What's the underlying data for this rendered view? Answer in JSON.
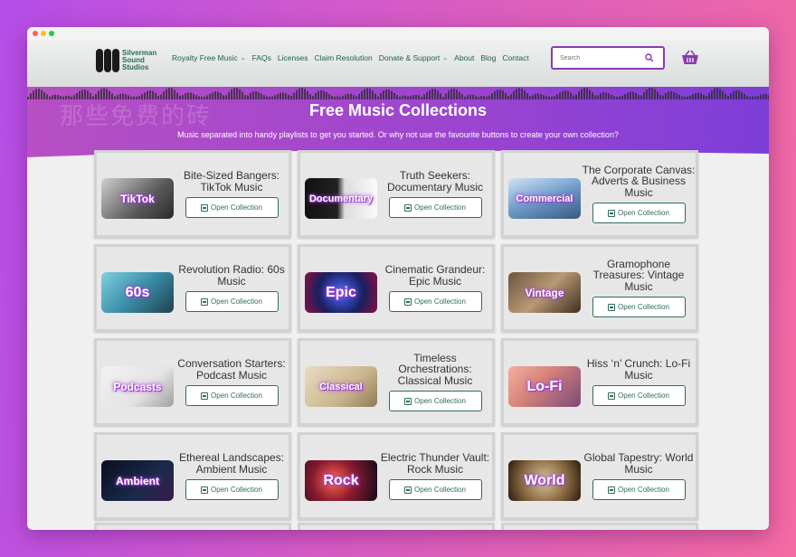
{
  "logo": {
    "lines": [
      "Silverman",
      "Sound",
      "Studios"
    ]
  },
  "nav": [
    {
      "label": "Royalty Free Music",
      "dropdown": true
    },
    {
      "label": "FAQs",
      "dropdown": false
    },
    {
      "label": "Licenses",
      "dropdown": false
    },
    {
      "label": "Claim Resolution",
      "dropdown": false
    },
    {
      "label": "Donate & Support",
      "dropdown": true
    },
    {
      "label": "About",
      "dropdown": false
    },
    {
      "label": "Blog",
      "dropdown": false
    },
    {
      "label": "Contact",
      "dropdown": false
    }
  ],
  "search": {
    "placeholder": "Search"
  },
  "hero": {
    "watermark": "那些免费的砖",
    "title": "Free Music Collections",
    "subtitle": "Music separated into handy playlists to get you started. Or why not use the favourite buttons to create your own collection?"
  },
  "button_label": "Open Collection",
  "colors": {
    "accent": "#8a3ab0",
    "button": "#2f6c5e",
    "hero": "#9a44d0"
  },
  "collections": [
    {
      "title": "Bite-Sized Bangers: TikTok Music",
      "thumb": "TikTok",
      "bg": "linear-gradient(135deg,#cfcfcf,#5a5a5a 60%,#2a2a2a)"
    },
    {
      "title": "Truth Seekers: Documentary Music",
      "thumb": "Documentary",
      "bg": "linear-gradient(90deg,#111 0%,#222 45%,#ddd 55%,#fafafa 100%)"
    },
    {
      "title": "The Corporate Canvas: Adverts & Business Music",
      "thumb": "Commercial",
      "bg": "linear-gradient(160deg,#cfe3f6,#6f9bc9 50%,#37597f)"
    },
    {
      "title": "Revolution Radio: 60s Music",
      "thumb": "60s",
      "bg": "linear-gradient(135deg,#7fd0e0,#3a8fa8 50%,#20404f)"
    },
    {
      "title": "Cinematic Grandeur: Epic Music",
      "thumb": "Epic",
      "bg": "radial-gradient(circle at 50% 50%,#4a6cff,#1a1f5f 55%,#8a1040 100%)"
    },
    {
      "title": "Gramophone Treasures: Vintage Music",
      "thumb": "Vintage",
      "bg": "linear-gradient(135deg,#6b5540,#b89a74 50%,#3e2e20)"
    },
    {
      "title": "Conversation Starters: Podcast Music",
      "thumb": "Podcasts",
      "bg": "linear-gradient(135deg,#f2f2f2,#e3e3e3 60%,#a0a0a0)"
    },
    {
      "title": "Timeless Orchestrations: Classical Music",
      "thumb": "Classical",
      "bg": "linear-gradient(135deg,#e8dcc0,#c9b68e 60%,#8f7a52)"
    },
    {
      "title": "Hiss ‘n’ Crunch: Lo-Fi Music",
      "thumb": "Lo-Fi",
      "bg": "linear-gradient(135deg,#f0b0a0,#d9857a 40%,#7a4a7a)"
    },
    {
      "title": "Ethereal Landscapes: Ambient Music",
      "thumb": "Ambient",
      "bg": "linear-gradient(135deg,#0a0f1f,#1a2a4a 60%,#3a1a4a)"
    },
    {
      "title": "Electric Thunder Vault: Rock Music",
      "thumb": "Rock",
      "bg": "radial-gradient(circle at 40% 50%,#ff6a4a,#8a1a30 45%,#120a1a 100%)"
    },
    {
      "title": "Global Tapestry: World Music",
      "thumb": "World",
      "bg": "radial-gradient(circle at 50% 50%,#d8c8a0,#8a6a40 55%,#2a1a10 100%)"
    }
  ]
}
